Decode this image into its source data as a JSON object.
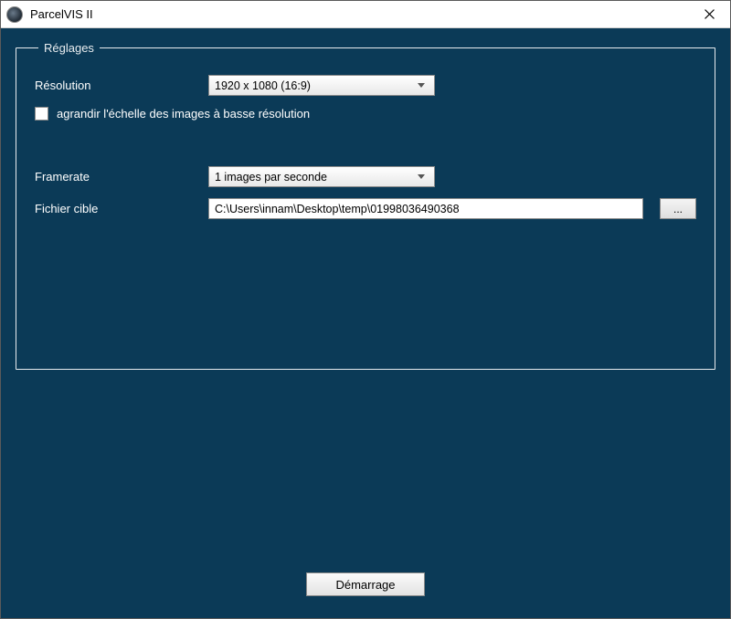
{
  "window": {
    "title": "ParcelVIS II"
  },
  "group": {
    "legend": "Réglages"
  },
  "resolution": {
    "label": "Résolution",
    "selected": "1920 x 1080 (16:9)"
  },
  "upscale": {
    "label": "agrandir l'échelle des images à basse résolution",
    "checked": false
  },
  "framerate": {
    "label": "Framerate",
    "selected": "1 images par seconde"
  },
  "target_file": {
    "label": "Fichier cible",
    "value": "C:\\Users\\innam\\Desktop\\temp\\01998036490368",
    "browse_label": "..."
  },
  "start": {
    "label": "Démarrage"
  }
}
